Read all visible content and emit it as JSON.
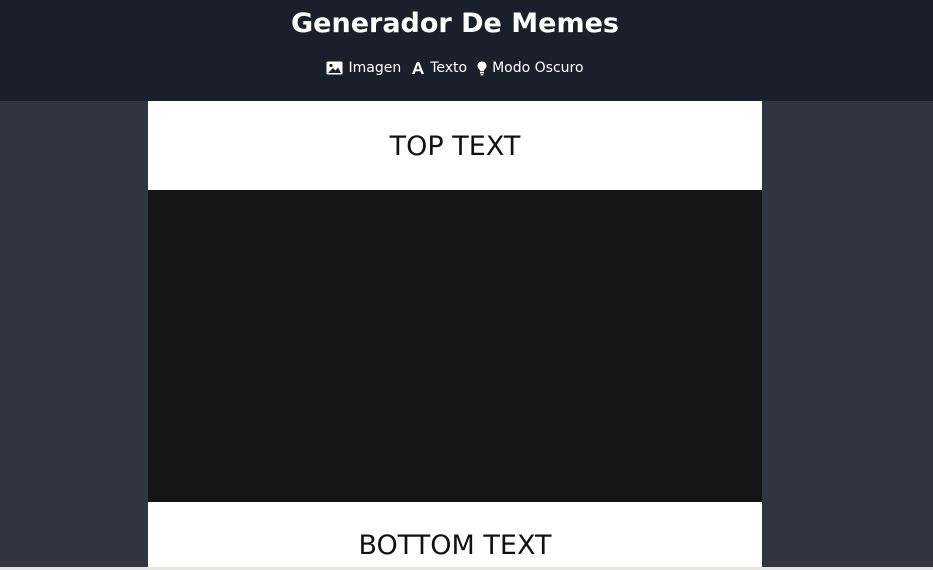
{
  "header": {
    "title": "Generador De Memes",
    "nav": [
      {
        "label": "Imagen",
        "icon": "image-icon"
      },
      {
        "label": "Texto",
        "icon": "text-font-icon"
      },
      {
        "label": "Modo Oscuro",
        "icon": "lightbulb-icon"
      }
    ]
  },
  "meme": {
    "top_text": "TOP TEXT",
    "bottom_text": "BOTTOM TEXT"
  },
  "colors": {
    "header_bg": "#1b1f2c",
    "page_bg": "#313542",
    "image_bg": "#151515",
    "caption_bg": "#ffffff"
  }
}
